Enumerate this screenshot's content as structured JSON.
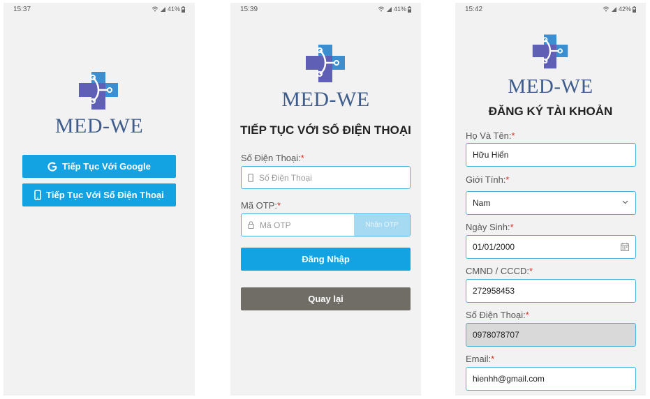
{
  "screens": {
    "welcome": {
      "time": "15:37",
      "battery": "41%",
      "brand": "MED-WE",
      "google_button": "Tiếp Tục Với Google",
      "phone_button": "Tiếp Tục Với Số Điện Thoại"
    },
    "phone_login": {
      "time": "15:39",
      "battery": "41%",
      "brand": "MED-WE",
      "title": "TIẾP TỤC VỚI SỐ ĐIỆN THOẠI",
      "phone_label": "Số Điện Thoại:",
      "phone_placeholder": "Số Điện Thoại",
      "otp_label": "Mã OTP:",
      "otp_placeholder": "Mã OTP",
      "otp_button": "Nhận OTP",
      "login_button": "Đăng Nhập",
      "back_button": "Quay lại"
    },
    "register": {
      "time": "15:42",
      "battery": "42%",
      "brand": "MED-WE",
      "title": "ĐĂNG KÝ TÀI KHOẢN",
      "fields": {
        "name_label": "Họ Và Tên:",
        "name_value": "Hữu Hiển",
        "gender_label": "Giới Tính:",
        "gender_value": "Nam",
        "dob_label": "Ngày Sinh:",
        "dob_value": "01/01/2000",
        "id_label": "CMND / CCCD:",
        "id_value": "272958453",
        "phone_label": "Số Điện Thoại:",
        "phone_value": "0978078707",
        "email_label": "Email:",
        "email_value": "hienhh@gmail.com"
      }
    }
  },
  "required_mark": "*",
  "colors": {
    "accent": "#14a3e2",
    "brand": "#3e5d8c",
    "back_button": "#706d67",
    "required": "#d93025"
  },
  "icons": [
    "google-icon",
    "smartphone-icon",
    "lock-icon",
    "calendar-icon",
    "chevron-down-icon",
    "wifi-icon",
    "signal-icon",
    "battery-icon"
  ]
}
